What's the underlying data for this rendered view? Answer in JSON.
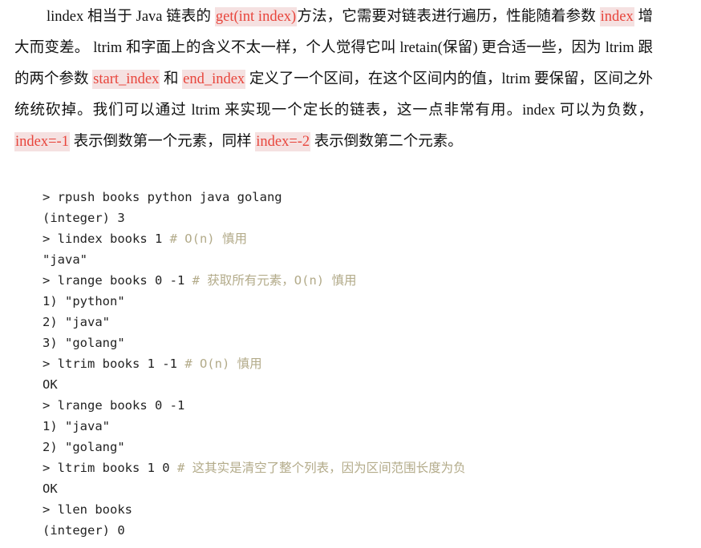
{
  "paragraph": {
    "t1": "lindex 相当于 Java 链表的 ",
    "h1": "get(int index)",
    "t2": "方法，它需要对链表进行遍历，性能随着参数 ",
    "h2": "index",
    "t3": " 增大而变差。 ltrim 和字面上的含义不太一样，个人觉得它叫 lretain(保留) 更合适一些，因为 ltrim 跟的两个参数 ",
    "h3": "start_index",
    "t4": " 和 ",
    "h4": "end_index",
    "t5": " 定义了一个区间，在这个区间内的值，ltrim 要保留，区间之外统统砍掉。我们可以通过 ltrim 来实现一个定长的链表，这一点非常有用。index 可以为负数，",
    "h5": "index=-1",
    "t6": " 表示倒数第一个元素，同样 ",
    "h6": "index=-2",
    "t7": " 表示倒数第二个元素。"
  },
  "code": [
    {
      "cmd": "> rpush books python java golang",
      "comment": ""
    },
    {
      "cmd": "(integer) 3",
      "comment": ""
    },
    {
      "cmd": "> lindex books 1 ",
      "comment": "# O(n) 慎用"
    },
    {
      "cmd": "\"java\"",
      "comment": ""
    },
    {
      "cmd": "> lrange books 0 -1 ",
      "comment": "# 获取所有元素，O(n) 慎用"
    },
    {
      "cmd": "1) \"python\"",
      "comment": ""
    },
    {
      "cmd": "2) \"java\"",
      "comment": ""
    },
    {
      "cmd": "3) \"golang\"",
      "comment": ""
    },
    {
      "cmd": "> ltrim books 1 -1 ",
      "comment": "# O(n) 慎用"
    },
    {
      "cmd": "OK",
      "comment": ""
    },
    {
      "cmd": "> lrange books 0 -1",
      "comment": ""
    },
    {
      "cmd": "1) \"java\"",
      "comment": ""
    },
    {
      "cmd": "2) \"golang\"",
      "comment": ""
    },
    {
      "cmd": "> ltrim books 1 0 ",
      "comment": "# 这其实是清空了整个列表，因为区间范围长度为负"
    },
    {
      "cmd": "OK",
      "comment": ""
    },
    {
      "cmd": "> llen books",
      "comment": ""
    },
    {
      "cmd": "(integer) 0",
      "comment": ""
    }
  ]
}
